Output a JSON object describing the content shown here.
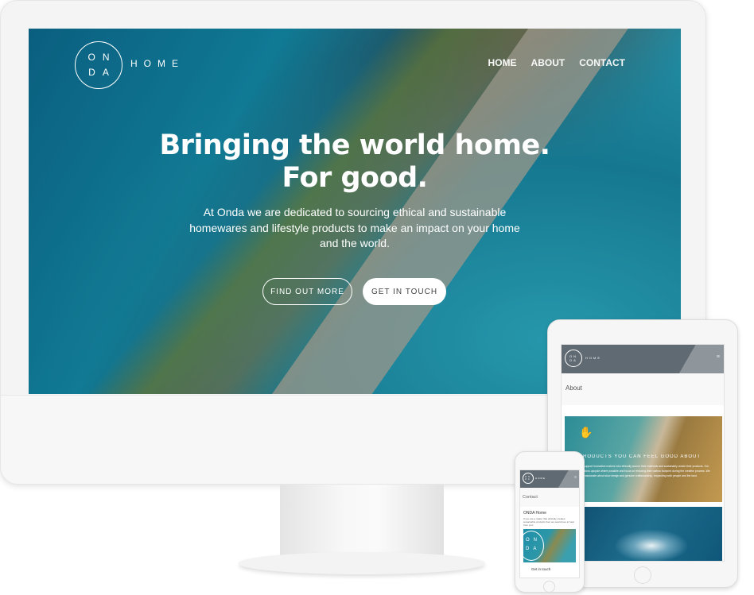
{
  "desktop": {
    "logo": {
      "line1": "ON",
      "line2": "DA"
    },
    "brand": "HOME",
    "nav": [
      "HOME",
      "ABOUT",
      "CONTACT"
    ],
    "headline": [
      "Bringing the world home.",
      "For good."
    ],
    "subtext": "At Onda we are dedicated to sourcing ethical and sustainable homewares and lifestyle products to make an impact on your home and the world.",
    "buttons": {
      "primary": "FIND OUT MORE",
      "secondary": "GET IN TOUCH"
    }
  },
  "tablet": {
    "logo": {
      "line1": "ON",
      "line2": "DA"
    },
    "brand": "HOME",
    "menu_icon": "hamburger-icon",
    "section_title": "About",
    "card_title": "PRODUCTS YOU CAN FEEL GOOD ABOUT",
    "card_text": "We support innovative makers who ethically source their materials and sustainably create their products. Our creations upcycle where possible and focus on reducing their carbon footprint during the creative process. We are passionate about slow design and genuine craftsmanship, respecting both people and the land."
  },
  "phone": {
    "logo": {
      "line1": "ON",
      "line2": "DA"
    },
    "brand": "HOME",
    "section_title": "Contact",
    "heading": "ONDA Home",
    "text": "If you are a maker that ethically creates sustainable products then we would love to hear from you!",
    "image_logo": {
      "line1": "ON",
      "line2": "DA"
    },
    "cta": "Get in touch"
  }
}
